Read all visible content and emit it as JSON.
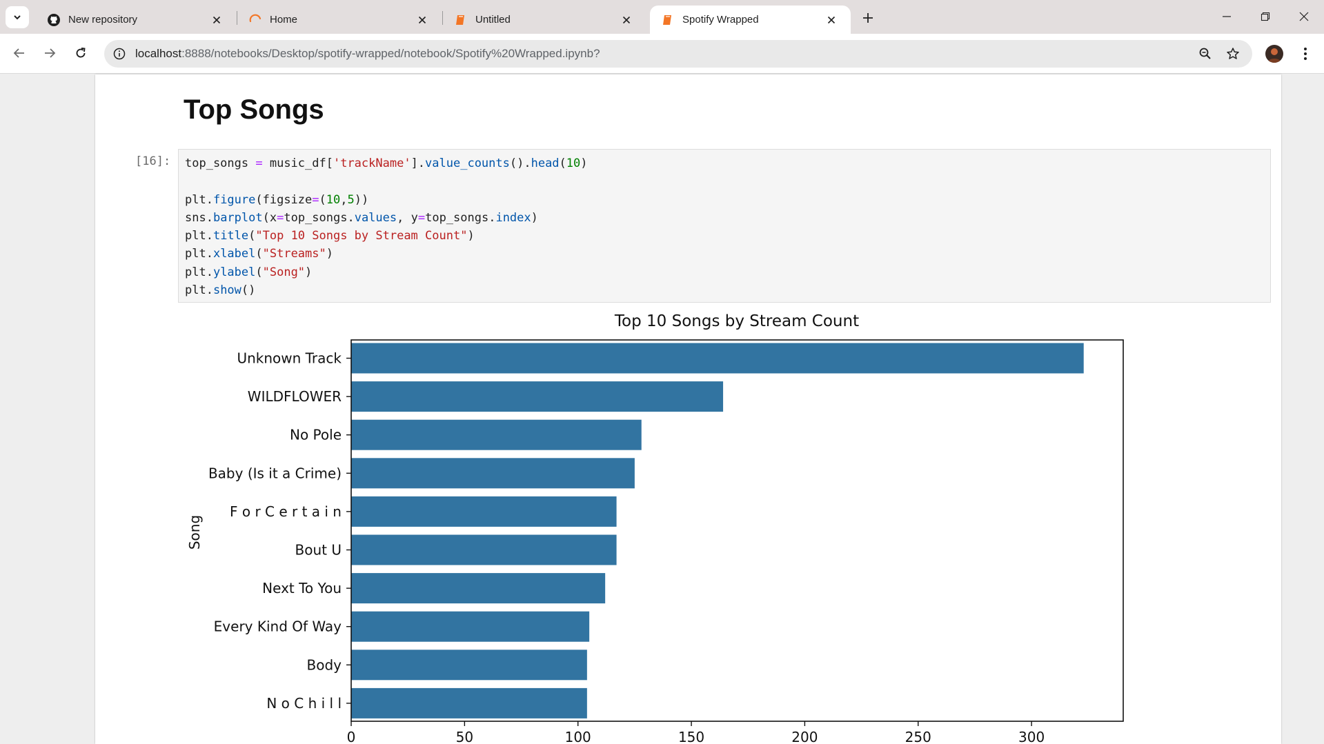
{
  "browser": {
    "tabs": [
      {
        "title": "New repository",
        "icon": "github-icon",
        "active": false
      },
      {
        "title": "Home",
        "icon": "jupyter-icon",
        "active": false
      },
      {
        "title": "Untitled",
        "icon": "notebook-icon",
        "active": false
      },
      {
        "title": "Spotify Wrapped",
        "icon": "notebook-icon",
        "active": true
      }
    ],
    "url_host": "localhost",
    "url_rest": ":8888/notebooks/Desktop/spotify-wrapped/notebook/Spotify%20Wrapped.ipynb?",
    "accent_tab_icon": "#f37626"
  },
  "notebook": {
    "heading": "Top Songs",
    "cell_prompt": "[16]:",
    "code_lines": [
      "top_songs = music_df['trackName'].value_counts().head(10)",
      "",
      "plt.figure(figsize=(10,5))",
      "sns.barplot(x=top_songs.values, y=top_songs.index)",
      "plt.title(\"Top 10 Songs by Stream Count\")",
      "plt.xlabel(\"Streams\")",
      "plt.ylabel(\"Song\")",
      "plt.show()"
    ]
  },
  "chart_data": {
    "type": "bar",
    "orientation": "horizontal",
    "title": "Top 10 Songs by Stream Count",
    "xlabel": "",
    "ylabel": "Song",
    "categories": [
      "Unknown Track",
      "WILDFLOWER",
      "No Pole",
      "Baby (Is it a Crime)",
      "F o r C e r t a i n",
      "Bout U",
      "Next To You",
      "Every Kind Of Way",
      "Body",
      "N o C h i l l"
    ],
    "values": [
      323,
      164,
      128,
      125,
      117,
      117,
      112,
      105,
      104,
      104
    ],
    "xticks": [
      0,
      50,
      100,
      150,
      200,
      250,
      300
    ],
    "xlim": [
      0,
      340
    ],
    "bar_color": "#3274a1",
    "grid": false
  }
}
